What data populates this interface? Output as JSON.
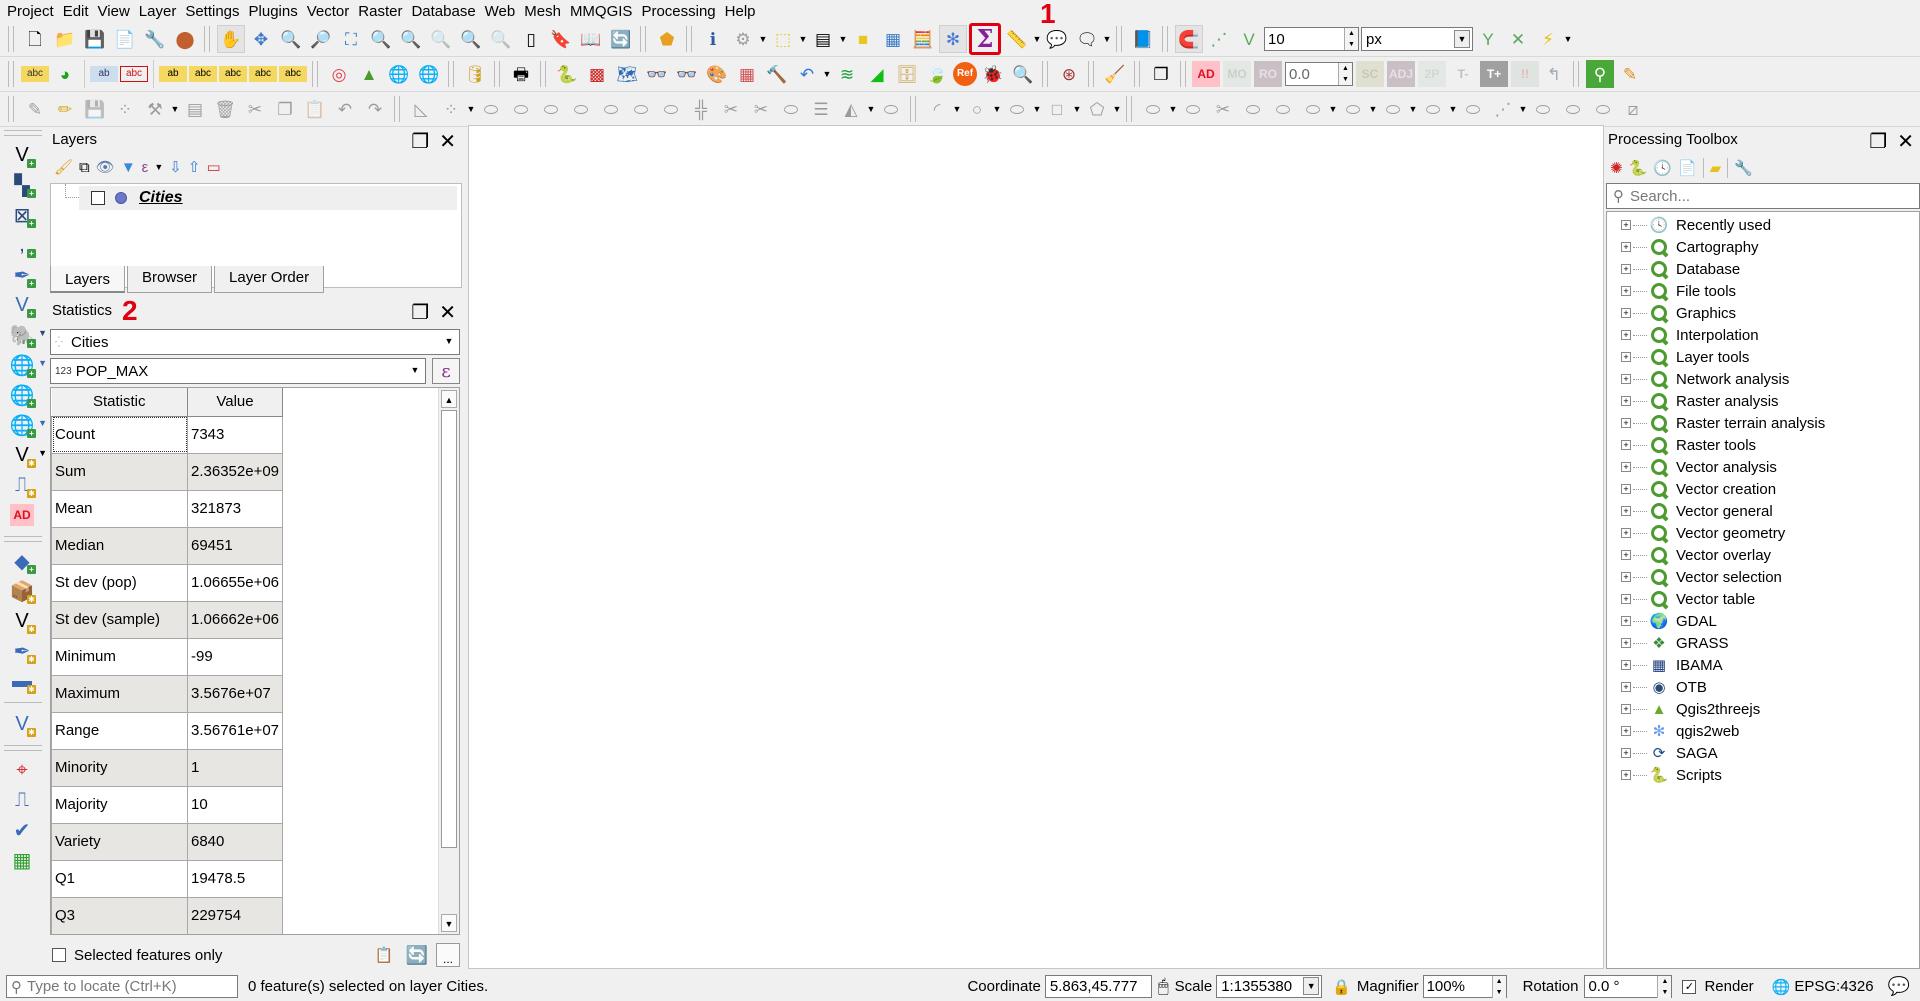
{
  "menubar": {
    "items": [
      "Project",
      "Edit",
      "View",
      "Layer",
      "Settings",
      "Plugins",
      "Vector",
      "Raster",
      "Database",
      "Web",
      "Mesh",
      "MMQGIS",
      "Processing",
      "Help"
    ]
  },
  "toolbar": {
    "snap_tolerance": "10",
    "snap_units": "px",
    "advanced_digitize_value": "0.0",
    "ad_label": "AD",
    "mo_label": "MO",
    "ro_label": "RO",
    "sc_label": "SC",
    "adj_label": "ADJ",
    "p2_label": "2P",
    "tminus_label": "T-",
    "tplus_label": "T+",
    "excl_label": "!!",
    "ref_label": "Ref",
    "sigma_symbol": "Σ"
  },
  "annotations": {
    "marker_1": "1",
    "marker_2": "2"
  },
  "left_toolbar": {
    "ad_label": "AD"
  },
  "layers_panel": {
    "title": "Layers",
    "layers": [
      {
        "name": "Cities",
        "checked": false,
        "symbol_color": "#6a78c8"
      }
    ],
    "tabs": [
      "Layers",
      "Browser",
      "Layer Order"
    ],
    "active_tab": "Layers"
  },
  "statistics_panel": {
    "title": "Statistics",
    "layer": "Cities",
    "field_type": "123",
    "field": "POP_MAX",
    "expression_symbol": "ε",
    "columns": [
      "Statistic",
      "Value"
    ],
    "rows": [
      {
        "statistic": "Count",
        "value": "7343"
      },
      {
        "statistic": "Sum",
        "value": "2.36352e+09"
      },
      {
        "statistic": "Mean",
        "value": "321873"
      },
      {
        "statistic": "Median",
        "value": "69451"
      },
      {
        "statistic": "St dev (pop)",
        "value": "1.06655e+06"
      },
      {
        "statistic": "St dev (sample)",
        "value": "1.06662e+06"
      },
      {
        "statistic": "Minimum",
        "value": "-99"
      },
      {
        "statistic": "Maximum",
        "value": "3.5676e+07"
      },
      {
        "statistic": "Range",
        "value": "3.56761e+07"
      },
      {
        "statistic": "Minority",
        "value": "1"
      },
      {
        "statistic": "Majority",
        "value": "10"
      },
      {
        "statistic": "Variety",
        "value": "6840"
      },
      {
        "statistic": "Q1",
        "value": "19478.5"
      },
      {
        "statistic": "Q3",
        "value": "229754"
      }
    ],
    "selected_only_label": "Selected features only",
    "selected_only_checked": false,
    "more_label": "..."
  },
  "processing_toolbox": {
    "title": "Processing Toolbox",
    "search_placeholder": "Search...",
    "items": [
      {
        "label": "Recently used",
        "icon": "clock-icon"
      },
      {
        "label": "Cartography",
        "icon": "qgis-icon"
      },
      {
        "label": "Database",
        "icon": "qgis-icon"
      },
      {
        "label": "File tools",
        "icon": "qgis-icon"
      },
      {
        "label": "Graphics",
        "icon": "qgis-icon"
      },
      {
        "label": "Interpolation",
        "icon": "qgis-icon"
      },
      {
        "label": "Layer tools",
        "icon": "qgis-icon"
      },
      {
        "label": "Network analysis",
        "icon": "qgis-icon"
      },
      {
        "label": "Raster analysis",
        "icon": "qgis-icon"
      },
      {
        "label": "Raster terrain analysis",
        "icon": "qgis-icon"
      },
      {
        "label": "Raster tools",
        "icon": "qgis-icon"
      },
      {
        "label": "Vector analysis",
        "icon": "qgis-icon"
      },
      {
        "label": "Vector creation",
        "icon": "qgis-icon"
      },
      {
        "label": "Vector general",
        "icon": "qgis-icon"
      },
      {
        "label": "Vector geometry",
        "icon": "qgis-icon"
      },
      {
        "label": "Vector overlay",
        "icon": "qgis-icon"
      },
      {
        "label": "Vector selection",
        "icon": "qgis-icon"
      },
      {
        "label": "Vector table",
        "icon": "qgis-icon"
      },
      {
        "label": "GDAL",
        "icon": "gdal-icon"
      },
      {
        "label": "GRASS",
        "icon": "grass-icon"
      },
      {
        "label": "IBAMA",
        "icon": "ibama-icon"
      },
      {
        "label": "OTB",
        "icon": "otb-icon"
      },
      {
        "label": "Qgis2threejs",
        "icon": "qgis2threejs-icon"
      },
      {
        "label": "qgis2web",
        "icon": "qgis2web-icon"
      },
      {
        "label": "SAGA",
        "icon": "saga-icon"
      },
      {
        "label": "Scripts",
        "icon": "python-icon"
      }
    ]
  },
  "statusbar": {
    "locate_placeholder": "Type to locate (Ctrl+K)",
    "message": "0 feature(s) selected on layer Cities.",
    "coordinate_label": "Coordinate",
    "coordinate_value": "5.863,45.777",
    "scale_label": "Scale",
    "scale_value": "1:1355380",
    "magnifier_label": "Magnifier",
    "magnifier_value": "100%",
    "rotation_label": "Rotation",
    "rotation_value": "0.0 °",
    "render_label": "Render",
    "render_checked": true,
    "crs_label": "EPSG:4326"
  },
  "colors": {
    "annotation_red": "#e00010",
    "sigma_purple": "#8b1d9b",
    "layer_symbol": "#6a78c8",
    "qgis_green": "#4d9a2f"
  }
}
